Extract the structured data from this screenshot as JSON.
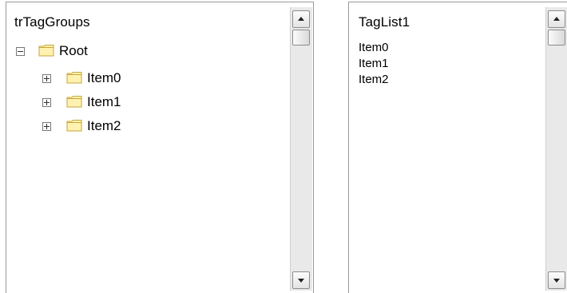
{
  "tree": {
    "title": "trTagGroups",
    "root": {
      "label": "Root",
      "expanded": true
    },
    "children": [
      {
        "label": "Item0",
        "expanded": false
      },
      {
        "label": "Item1",
        "expanded": false
      },
      {
        "label": "Item2",
        "expanded": false
      }
    ]
  },
  "list": {
    "title": "TagList1",
    "items": [
      "Item0",
      "Item1",
      "Item2"
    ]
  },
  "icons": {
    "folder": "folder-icon",
    "expand": "plus-box-icon",
    "collapse": "minus-box-icon",
    "scroll_up": "arrow-up-icon",
    "scroll_down": "arrow-down-icon"
  },
  "colors": {
    "folder_fill": "#fff2b0",
    "folder_stroke": "#c9a53a",
    "border": "#9a9a9a",
    "scroll_track": "#e9e9e9"
  }
}
